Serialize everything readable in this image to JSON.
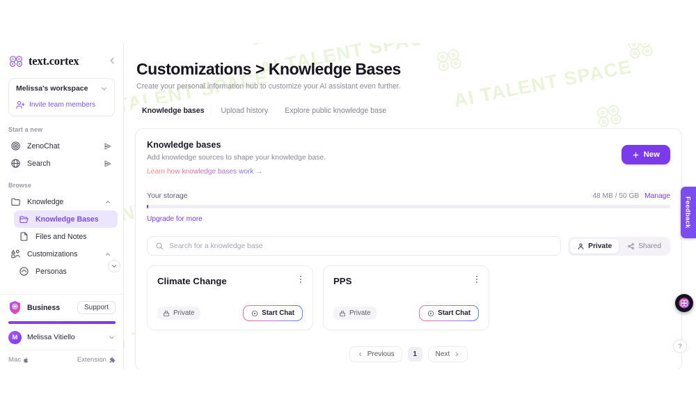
{
  "brand": {
    "name": "text.cortex",
    "collapse_icon": "chevron-left-icon"
  },
  "sidebar": {
    "workspace": {
      "name": "Melissa's workspace",
      "chevron_icon": "chevron-down-icon",
      "invite_label": "Invite team members",
      "invite_icon": "user-plus-icon"
    },
    "start_heading": "Start a new",
    "start_items": [
      {
        "label": "ZenoChat",
        "icon": "zeno-orb-icon",
        "trailing_icon": "send-icon"
      },
      {
        "label": "Search",
        "icon": "globe-icon",
        "trailing_icon": "send-icon"
      }
    ],
    "browse_heading": "Browse",
    "browse_items": [
      {
        "label": "Knowledge",
        "icon": "folder-icon",
        "chevron": "chevron-up-icon",
        "level": 0,
        "active": false
      },
      {
        "label": "Knowledge Bases",
        "icon": "folder-open-icon",
        "level": 1,
        "active": true
      },
      {
        "label": "Files and Notes",
        "icon": "file-icon",
        "level": 1,
        "active": false
      },
      {
        "label": "Customizations",
        "icon": "customizations-icon",
        "chevron": "chevron-up-icon",
        "level": 0,
        "active": false
      },
      {
        "label": "Personas",
        "icon": "persona-icon",
        "level": 1,
        "active": false
      }
    ],
    "plan": {
      "name": "Business",
      "shield_icon": "shield-brain-icon",
      "support_label": "Support"
    },
    "user": {
      "initial": "M",
      "name": "Melissa Vitiello",
      "chevron_icon": "chevron-down-icon"
    },
    "footer": {
      "mac_label": "Mac",
      "mac_icon": "apple-icon",
      "extension_label": "Extension",
      "extension_icon": "puzzle-icon"
    }
  },
  "header": {
    "title_prefix": "Customizations",
    "title_separator": " > ",
    "title_current": "Knowledge Bases",
    "subtitle": "Create your personal information hub to customize your AI assistant even further."
  },
  "tabs": [
    {
      "label": "Knowledge bases",
      "active": true
    },
    {
      "label": "Upload history",
      "active": false
    },
    {
      "label": "Explore public knowledge base",
      "active": false
    }
  ],
  "panel": {
    "heading": "Knowledge bases",
    "subheading": "Add knowledge sources to shape your knowledge base.",
    "learn_link": "Learn how knowledge bases work →",
    "new_button": "New",
    "new_button_icon": "plus-icon",
    "storage": {
      "label": "Your storage",
      "used": "48 MB / 50 GB",
      "manage_label": "Manage",
      "percent": 0.1,
      "upgrade_label": "Upgrade for more"
    },
    "search": {
      "placeholder": "Search for a knowledge base",
      "value": "",
      "icon": "search-icon"
    },
    "filters": [
      {
        "label": "Private",
        "icon": "person-icon",
        "active": true
      },
      {
        "label": "Shared",
        "icon": "share-icon",
        "active": false
      }
    ]
  },
  "cards": [
    {
      "title": "Climate Change",
      "menu_icon": "kebab-menu-icon",
      "visibility": "Private",
      "visibility_icon": "lock-icon",
      "action_label": "Start Chat",
      "action_icon": "play-circle-icon"
    },
    {
      "title": "PPS",
      "menu_icon": "kebab-menu-icon",
      "visibility": "Private",
      "visibility_icon": "lock-icon",
      "action_label": "Start Chat",
      "action_icon": "play-circle-icon"
    }
  ],
  "pagination": {
    "previous_label": "Previous",
    "previous_icon": "chevron-left-icon",
    "current_page": "1",
    "next_label": "Next",
    "next_icon": "chevron-right-icon"
  },
  "floaters": {
    "feedback_label": "Feedback",
    "help_label": "?",
    "cortex_icon": "cortex-brain-icon"
  },
  "watermark": {
    "text": "AI TALENT SPACE",
    "color": "#e9f4d9"
  },
  "colors": {
    "accent": "#7c3aed",
    "accent_soft": "#ece6fd",
    "text_primary": "#17131f",
    "text_muted": "#8b8696",
    "border": "#edebf1"
  }
}
